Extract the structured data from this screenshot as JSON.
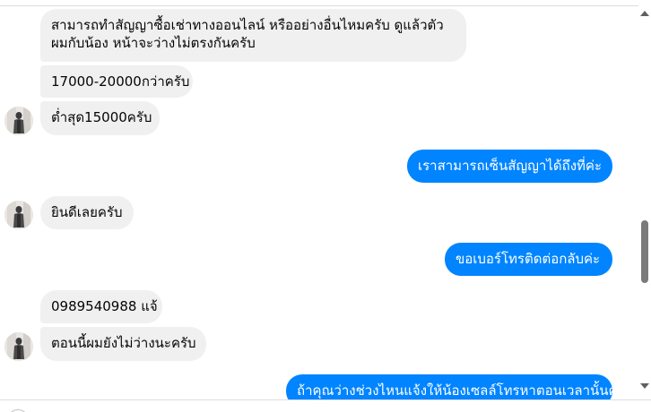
{
  "conversation": {
    "messages": [
      {
        "side": "in",
        "lines": [
          "สามารถทำสัญญาซื้อเช่าทางออนไลน์ หรืออย่างอื่นไหมครับ ดูแล้วตัว",
          "ผมกับน้อง หน้าจะว่างไม่ตรงกันครับ"
        ]
      },
      {
        "side": "in",
        "lines": [
          "17000-20000กว่าครับ"
        ]
      },
      {
        "side": "in",
        "lines": [
          "ต่ำสุด15000ครับ"
        ]
      },
      {
        "side": "out",
        "lines": [
          "เราสามารถเซ็นสัญญาได้ถึงที่ค่ะ"
        ]
      },
      {
        "side": "in",
        "lines": [
          "ยินดีเลยครับ"
        ]
      },
      {
        "side": "out",
        "lines": [
          "ขอเบอร์โทรติดต่อกลับค่ะ"
        ]
      },
      {
        "side": "in",
        "lines": [
          "0989540988 แจ้"
        ]
      },
      {
        "side": "in",
        "lines": [
          "ตอนนี้ผมยังไม่ว่างนะครับ"
        ]
      },
      {
        "side": "out",
        "lines": [
          "ถ้าคุณว่างช่วงไหนแจ้งให้น้องเซลล์โทรหาตอนเวลานั้นค่ะ"
        ]
      }
    ]
  },
  "colors": {
    "incoming_bubble": "#f0f0f0",
    "outgoing_bubble": "#0084ff",
    "incoming_text": "#050505",
    "outgoing_text": "#ffffff"
  },
  "icons": {
    "avatar": "avatar-icon",
    "scroll_up": "chevron-up-icon",
    "scroll_down": "chevron-down-icon"
  }
}
